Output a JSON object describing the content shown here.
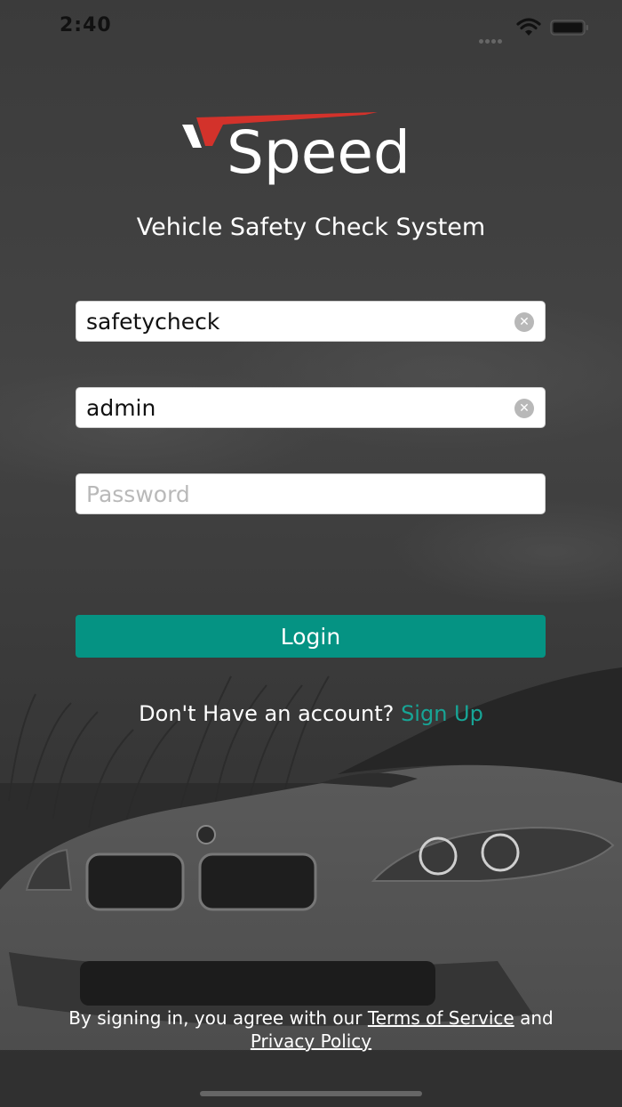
{
  "status": {
    "time": "2:40"
  },
  "brand": {
    "logo_text": "Speed",
    "subtitle": "Vehicle Safety Check System",
    "accent": "#d3322b"
  },
  "form": {
    "username_value": "safetycheck",
    "company_value": "admin",
    "password_value": "",
    "password_placeholder": "Password",
    "login_label": "Login"
  },
  "signup": {
    "prompt": "Don't Have an account?",
    "link": "Sign Up",
    "link_color": "#17a596"
  },
  "terms": {
    "prefix": "By signing in, you agree with our",
    "tos": "Terms of Service",
    "and": "and",
    "privacy": "Privacy Policy"
  },
  "colors": {
    "button": "#059383",
    "background": "#3a3a3a"
  }
}
